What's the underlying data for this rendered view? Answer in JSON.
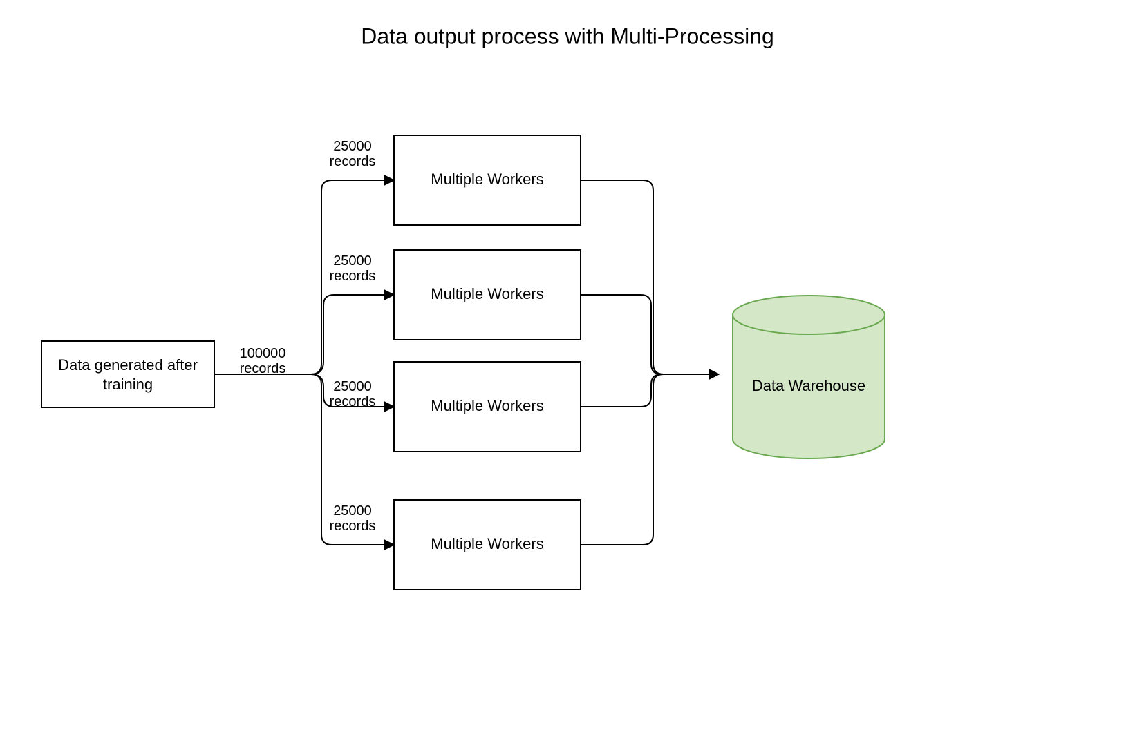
{
  "title": "Data output process with Multi-Processing",
  "source": {
    "line1": "Data generated after",
    "line2": "training"
  },
  "source_edge_label_line1": "100000",
  "source_edge_label_line2": "records",
  "worker_label": "Multiple Workers",
  "worker_edge_label_line1": "25000",
  "worker_edge_label_line2": "records",
  "target_label": "Data Warehouse",
  "colors": {
    "stroke": "#000000",
    "bg": "#ffffff",
    "db_fill": "#d4e8c8",
    "db_stroke": "#6aa84f"
  }
}
